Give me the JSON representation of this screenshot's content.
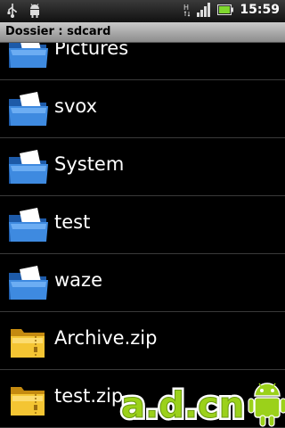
{
  "status_bar": {
    "time": "15:59",
    "icons": [
      "usb-icon",
      "android-debug-icon",
      "signal-h-icon",
      "signal-bars-icon",
      "battery-icon"
    ],
    "signal_type_label": "H"
  },
  "title_bar": {
    "title": "Dossier : sdcard"
  },
  "files": [
    {
      "name": "Pictures",
      "type": "folder"
    },
    {
      "name": "svox",
      "type": "folder"
    },
    {
      "name": "System",
      "type": "folder"
    },
    {
      "name": "test",
      "type": "folder"
    },
    {
      "name": "waze",
      "type": "folder"
    },
    {
      "name": "Archive.zip",
      "type": "zip"
    },
    {
      "name": "test.zip",
      "type": "zip"
    }
  ],
  "watermark": {
    "text": "a.d.cn"
  },
  "colors": {
    "folder_blue": "#2f74c9",
    "zip_yellow": "#f4c533",
    "watermark_green": "#9bd11a"
  }
}
